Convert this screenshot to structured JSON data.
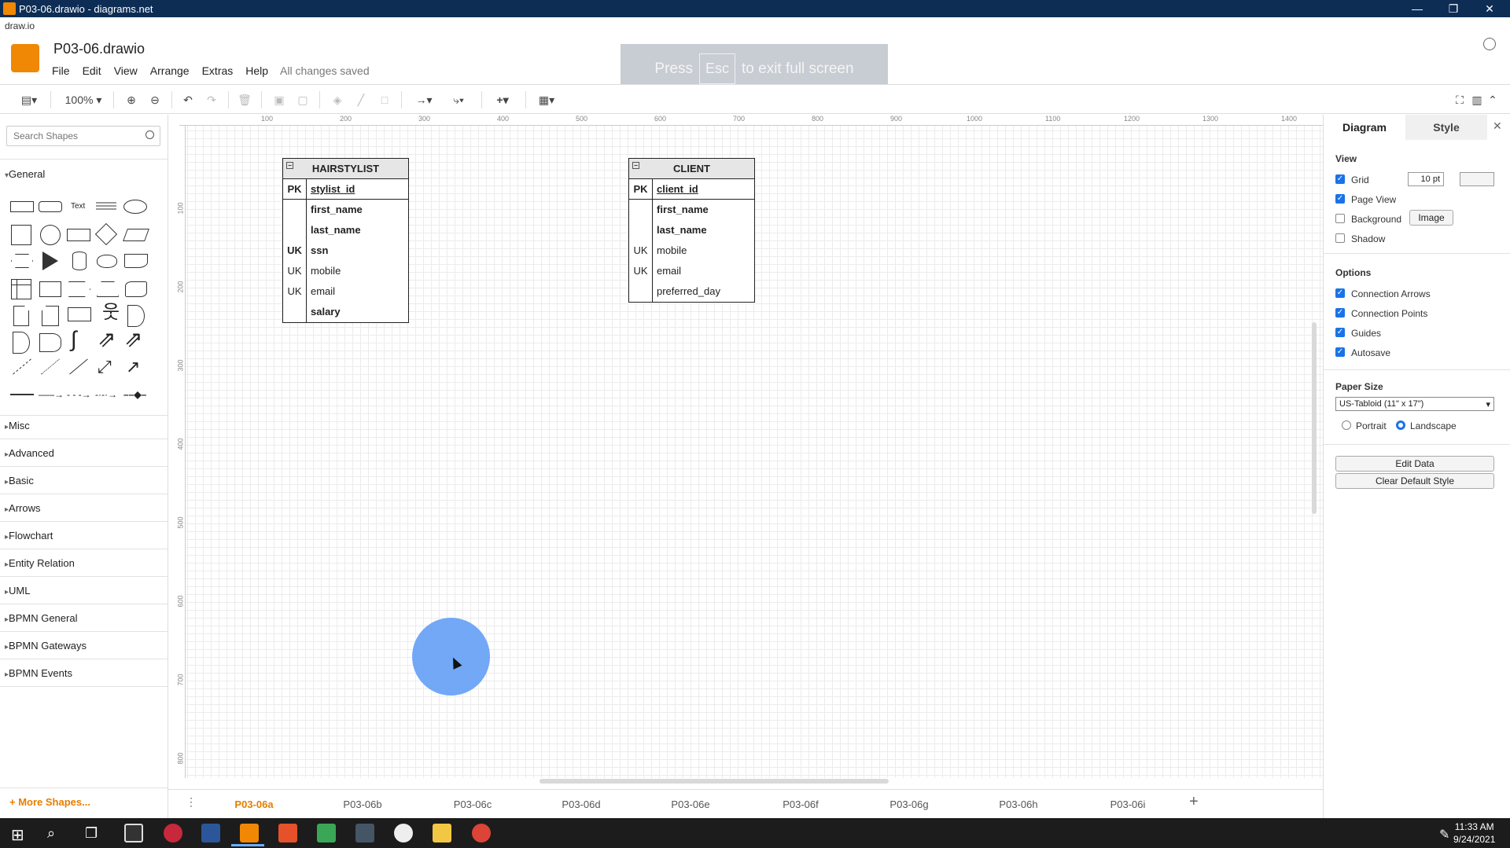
{
  "window": {
    "title": "P03-06.drawio - diagrams.net",
    "minimize": "—",
    "restore": "❐",
    "close": "✕"
  },
  "site_label": "draw.io",
  "file_name": "P03-06.drawio",
  "menu": [
    "File",
    "Edit",
    "View",
    "Arrange",
    "Extras",
    "Help"
  ],
  "save_status": "All changes saved",
  "fullscreen_notice": {
    "press": "Press",
    "key": "Esc",
    "rest": "to exit full screen"
  },
  "toolbar": {
    "zoom": "100%"
  },
  "search": {
    "placeholder": "Search Shapes"
  },
  "shape_sections": {
    "general": "General",
    "misc": "Misc",
    "advanced": "Advanced",
    "basic": "Basic",
    "arrows": "Arrows",
    "flowchart": "Flowchart",
    "entity_relation": "Entity Relation",
    "uml": "UML",
    "bpmn_general": "BPMN General",
    "bpmn_gateways": "BPMN Gateways",
    "bpmn_events": "BPMN Events"
  },
  "more_shapes": "+ More Shapes...",
  "text_shape_label": "Text",
  "ruler": {
    "h": [
      "100",
      "200",
      "300",
      "400",
      "500",
      "600",
      "700",
      "800",
      "900",
      "1000",
      "1100",
      "1200",
      "1300",
      "1400"
    ],
    "v": [
      "100",
      "200",
      "300",
      "400",
      "500",
      "600",
      "700",
      "800"
    ]
  },
  "hairstylist": {
    "title": "HAIRSTYLIST",
    "rows": [
      {
        "key": "PK",
        "field": "stylist_id"
      },
      {
        "key": "",
        "field": "first_name"
      },
      {
        "key": "",
        "field": "last_name"
      },
      {
        "key": "UK",
        "field": "ssn"
      },
      {
        "key": "UK",
        "field": "mobile"
      },
      {
        "key": "UK",
        "field": "email"
      },
      {
        "key": "",
        "field": "salary"
      }
    ]
  },
  "client": {
    "title": "CLIENT",
    "rows": [
      {
        "key": "PK",
        "field": "client_id"
      },
      {
        "key": "",
        "field": "first_name"
      },
      {
        "key": "",
        "field": "last_name"
      },
      {
        "key": "UK",
        "field": "mobile"
      },
      {
        "key": "UK",
        "field": "email"
      },
      {
        "key": "",
        "field": "preferred_day"
      }
    ]
  },
  "right_panel": {
    "tab_diagram": "Diagram",
    "tab_style": "Style",
    "view_heading": "View",
    "grid": "Grid",
    "grid_size": "10 pt",
    "page_view": "Page View",
    "background": "Background",
    "image_button": "Image",
    "shadow": "Shadow",
    "options_heading": "Options",
    "connection_arrows": "Connection Arrows",
    "connection_points": "Connection Points",
    "guides": "Guides",
    "autosave": "Autosave",
    "paper_size_heading": "Paper Size",
    "paper_size": "US-Tabloid (11\" x 17\")",
    "portrait": "Portrait",
    "landscape": "Landscape",
    "edit_data": "Edit Data",
    "clear_default_style": "Clear Default Style"
  },
  "page_tabs": [
    "P03-06a",
    "P03-06b",
    "P03-06c",
    "P03-06d",
    "P03-06e",
    "P03-06f",
    "P03-06g",
    "P03-06h",
    "P03-06i"
  ],
  "add_page": "+",
  "clock": {
    "time": "11:33 AM",
    "date": "9/24/2021"
  },
  "colors": {
    "accent": "#e67e00",
    "titlebar": "#0d2d55",
    "drawio_orange": "#f08705",
    "checkbox": "#1a73e8",
    "click_circle": "#6aa3f5"
  }
}
